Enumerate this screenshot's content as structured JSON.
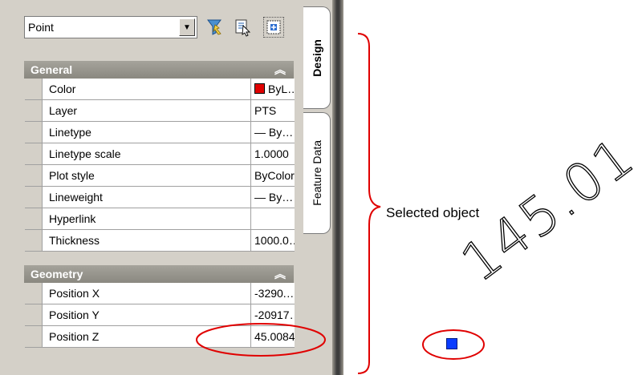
{
  "object_type": {
    "value": "Point"
  },
  "toolbar": {
    "filter_icon": "quick-select-funnel-icon",
    "select_icon": "select-objects-icon",
    "pickadd_icon": "toggle-pickadd-icon"
  },
  "tabs": [
    {
      "label": "Design",
      "active": true
    },
    {
      "label": "Feature Data",
      "active": false
    }
  ],
  "sections": {
    "general": {
      "title": "General",
      "rows": [
        {
          "name": "Color",
          "value": "ByL…",
          "swatch": "#e00000"
        },
        {
          "name": "Layer",
          "value": "PTS"
        },
        {
          "name": "Linetype",
          "value": "— By…"
        },
        {
          "name": "Linetype scale",
          "value": "1.0000"
        },
        {
          "name": "Plot style",
          "value": "ByColor"
        },
        {
          "name": "Lineweight",
          "value": "— By…"
        },
        {
          "name": "Hyperlink",
          "value": ""
        },
        {
          "name": "Thickness",
          "value": "1000.0…"
        }
      ]
    },
    "geometry": {
      "title": "Geometry",
      "rows": [
        {
          "name": "Position X",
          "value": "-3290.…"
        },
        {
          "name": "Position Y",
          "value": "-20917…"
        },
        {
          "name": "Position Z",
          "value": "45.0084"
        }
      ]
    }
  },
  "annotation": {
    "label": "Selected object",
    "highlight_color": "#e00000"
  },
  "drawing": {
    "elevation_text": "145.01",
    "point_color": "#0a3cff"
  }
}
